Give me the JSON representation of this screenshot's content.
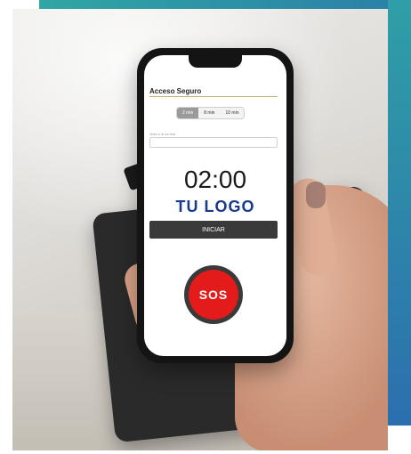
{
  "app": {
    "title": "Acceso Seguro"
  },
  "timer_options": [
    {
      "label": "2 min",
      "active": true
    },
    {
      "label": "8 min",
      "active": false
    },
    {
      "label": "10 min",
      "active": false
    }
  ],
  "field": {
    "label": "Nota a la central",
    "placeholder": ""
  },
  "timer": {
    "value": "02:00"
  },
  "logo": {
    "text": "TU LOGO"
  },
  "start_button": {
    "label": "INICIAR"
  },
  "sos": {
    "label": "SOS"
  },
  "colors": {
    "frame_teal": "#2fa7a3",
    "frame_blue": "#2b6fae",
    "logo_blue": "#193b8c",
    "sos_red": "#e31b1b"
  }
}
